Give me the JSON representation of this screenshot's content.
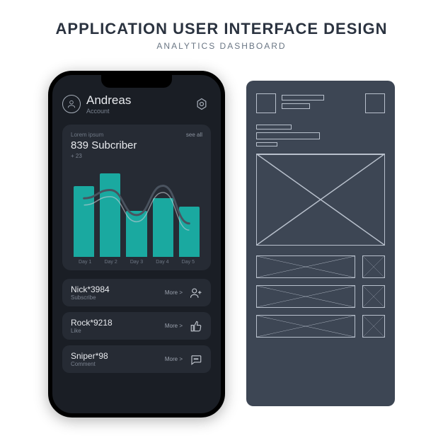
{
  "page": {
    "title": "APPLICATION USER INTERFACE DESIGN",
    "subtitle": "ANALYTICS DASHBOARD"
  },
  "header": {
    "user_name": "Andreas",
    "account_label": "Account"
  },
  "card": {
    "lorem": "Lorem ipsum",
    "see_all": "see all",
    "subscriber_line": "839 Subcriber",
    "delta": "+ 23"
  },
  "chart_data": {
    "type": "bar",
    "categories": [
      "Day 1",
      "Day 2",
      "Day 3",
      "Day 4",
      "Day 5"
    ],
    "values": [
      85,
      100,
      55,
      70,
      60
    ],
    "line_values": [
      70,
      80,
      50,
      85,
      40
    ],
    "title": "",
    "xlabel": "",
    "ylabel": "",
    "ylim": [
      0,
      110
    ]
  },
  "activity": [
    {
      "name": "Nick*3984",
      "action": "Subscribe",
      "more": "More  >",
      "icon": "user-plus-icon"
    },
    {
      "name": "Rock*9218",
      "action": "Like",
      "more": "More  >",
      "icon": "thumbs-up-icon"
    },
    {
      "name": "Sniper*98",
      "action": "Comment",
      "more": "More  >",
      "icon": "message-icon"
    }
  ],
  "colors": {
    "accent": "#1aa9a0",
    "panel": "#262b34",
    "bg": "#1a1e25",
    "wireframe_bg": "#3d4654",
    "wireframe_line": "#b8c0cc"
  }
}
